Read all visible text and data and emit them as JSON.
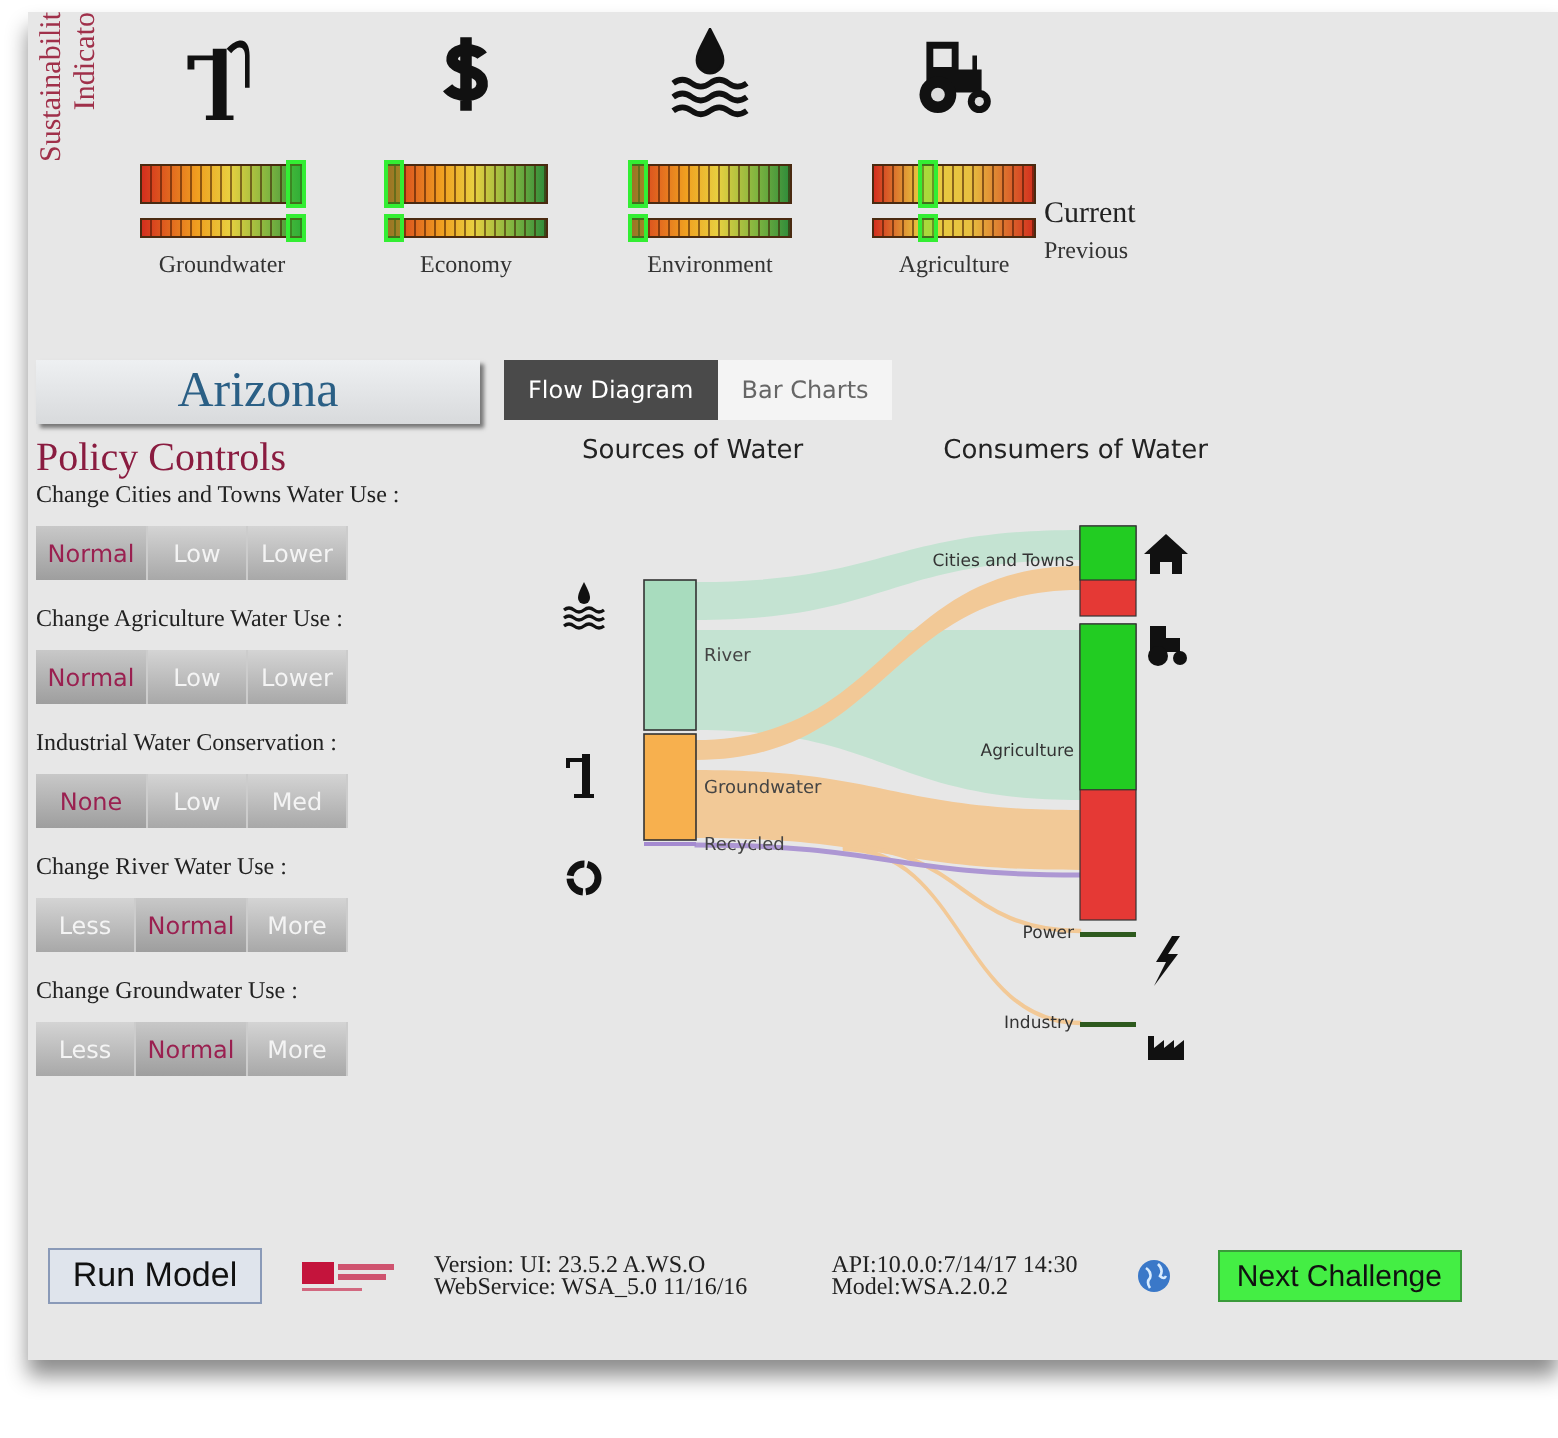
{
  "side_title": [
    "Sustainabilit",
    "Indicato"
  ],
  "indicators": [
    {
      "kind": "pump",
      "label": "Groundwater",
      "current": {
        "level": 0.94
      },
      "previous": {
        "level": 0.94
      }
    },
    {
      "kind": "dollar",
      "label": "Economy",
      "current": {
        "level": 0.03
      },
      "previous": {
        "level": 0.03
      }
    },
    {
      "kind": "water",
      "label": "Environment",
      "current": {
        "level": 0.03
      },
      "previous": {
        "level": 0.03
      }
    },
    {
      "kind": "tractor",
      "label": "Agriculture",
      "current": {
        "level": 0.31
      },
      "previous": {
        "level": 0.31
      }
    }
  ],
  "legend": {
    "current": "Current",
    "previous": "Previous"
  },
  "region": "Arizona",
  "tabs": [
    {
      "label": "Flow Diagram",
      "selected": true
    },
    {
      "label": "Bar Charts",
      "selected": false
    }
  ],
  "policy_title": "Policy Controls",
  "policies": [
    {
      "label": "Change Cities and Towns Water Use :",
      "options": [
        {
          "label": "Normal",
          "selected": true
        },
        {
          "label": "Low",
          "selected": false
        },
        {
          "label": "Lower",
          "selected": false
        }
      ]
    },
    {
      "label": "Change Agriculture Water Use :",
      "options": [
        {
          "label": "Normal",
          "selected": true
        },
        {
          "label": "Low",
          "selected": false
        },
        {
          "label": "Lower",
          "selected": false
        }
      ]
    },
    {
      "label": "Industrial Water Conservation :",
      "options": [
        {
          "label": "None",
          "selected": true
        },
        {
          "label": "Low",
          "selected": false
        },
        {
          "label": "Med",
          "selected": false
        }
      ]
    },
    {
      "label": "Change River Water Use :",
      "options": [
        {
          "label": "Less",
          "selected": false
        },
        {
          "label": "Normal",
          "selected": true
        },
        {
          "label": "More",
          "selected": false
        }
      ]
    },
    {
      "label": "Change Groundwater Use :",
      "options": [
        {
          "label": "Less",
          "selected": false
        },
        {
          "label": "Normal",
          "selected": true
        },
        {
          "label": "More",
          "selected": false
        }
      ]
    }
  ],
  "flow": {
    "sources_title": "Sources of Water",
    "consumers_title": "Consumers of Water",
    "sources": [
      {
        "kind": "river",
        "label": "River"
      },
      {
        "kind": "groundwater",
        "label": "Groundwater"
      },
      {
        "kind": "recycled",
        "label": "Recycled"
      }
    ],
    "consumers": [
      {
        "kind": "cities",
        "label": "Cities and Towns",
        "level": 0.6
      },
      {
        "kind": "agriculture",
        "label": "Agriculture",
        "level": 0.56
      },
      {
        "kind": "power",
        "label": "Power"
      },
      {
        "kind": "industry",
        "label": "Industry"
      }
    ]
  },
  "footer": {
    "run_button": "Run Model",
    "version": [
      "Version: UI: 23.5.2 A.WS.O",
      "WebService: WSA_5.0 11/16/16"
    ],
    "api": [
      "API:10.0.0:7/14/17 14:30",
      "Model:WSA.2.0.2"
    ],
    "next_button": "Next Challenge"
  }
}
